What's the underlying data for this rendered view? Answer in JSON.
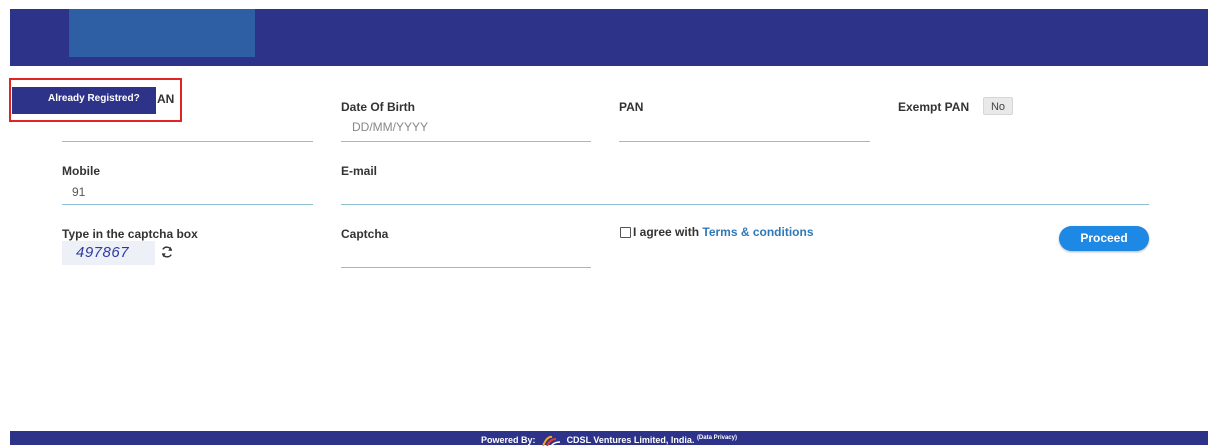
{
  "header": {},
  "already_registered": {
    "label": "Already Registred?",
    "partial_text": "AN"
  },
  "form": {
    "dob": {
      "label": "Date Of Birth",
      "placeholder": "DD/MM/YYYY"
    },
    "pan": {
      "label": "PAN"
    },
    "exempt_pan": {
      "label": "Exempt PAN",
      "toggle": "No"
    },
    "mobile": {
      "label": "Mobile",
      "value": "91"
    },
    "email": {
      "label": "E-mail"
    },
    "captcha_box": {
      "label": "Type in the captcha box",
      "code": "497867"
    },
    "captcha": {
      "label": "Captcha"
    },
    "agree": {
      "text": "I agree with",
      "link": "Terms & conditions"
    },
    "proceed": "Proceed"
  },
  "footer": {
    "powered_by": "Powered By:",
    "company": "CDSL Ventures Limited, India.",
    "privacy": "(Data Privacy)"
  },
  "colors": {
    "header_bg": "#2e338a",
    "accent": "#1e88e5",
    "link": "#2f79b8",
    "highlight": "#e02424"
  }
}
